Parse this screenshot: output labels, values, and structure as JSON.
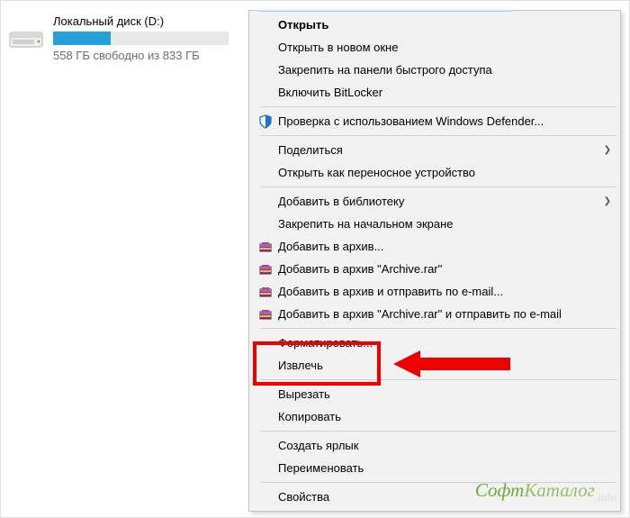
{
  "drive": {
    "title": "Локальный диск (D:)",
    "sub": "558 ГБ свободно из 833 ГБ",
    "fill_percent": 33
  },
  "menu": {
    "open": "Открыть",
    "open_new": "Открыть в новом окне",
    "pin_quick": "Закрепить на панели быстрого доступа",
    "bitlocker": "Включить BitLocker",
    "defender": "Проверка с использованием Windows Defender...",
    "share": "Поделиться",
    "portable": "Открыть как переносное устройство",
    "add_library": "Добавить в библиотеку",
    "pin_start": "Закрепить на начальном экране",
    "archive1": "Добавить в архив...",
    "archive2": "Добавить в архив \"Archive.rar\"",
    "archive3": "Добавить в архив и отправить по e-mail...",
    "archive4": "Добавить в архив \"Archive.rar\" и отправить по e-mail",
    "format": "Форматировать...",
    "eject": "Извлечь",
    "cut": "Вырезать",
    "copy": "Копировать",
    "shortcut": "Создать ярлык",
    "rename": "Переименовать",
    "properties": "Свойства"
  },
  "watermark": {
    "soft": "Софт",
    "kat": "Каталог",
    "info": ".info"
  }
}
